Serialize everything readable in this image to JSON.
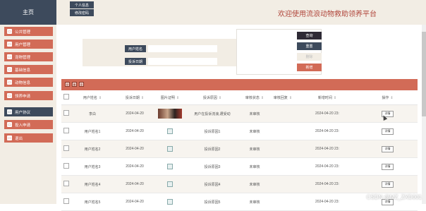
{
  "brand": "主页",
  "top_buttons": [
    "个人信息",
    "修改密码"
  ],
  "site_title": "欢迎使用流浪动物救助领养平台",
  "sidebar": [
    {
      "label": "公共管理",
      "icon": "monitor-icon",
      "active": false
    },
    {
      "label": "用户管理",
      "icon": "monitor-icon",
      "active": false
    },
    {
      "label": "宠物管理",
      "icon": "monitor-icon",
      "active": false
    },
    {
      "label": "基础信息",
      "icon": "monitor-icon",
      "active": false
    },
    {
      "label": "动物信息",
      "icon": "monitor-icon",
      "active": false
    },
    {
      "label": "领养申请",
      "icon": "monitor-icon",
      "active": false
    },
    {
      "label": "用户协议",
      "icon": "monitor-icon",
      "active": true
    },
    {
      "label": "投入申请",
      "icon": "monitor-icon",
      "active": false
    },
    {
      "label": "退出",
      "icon": "monitor-icon",
      "active": false
    }
  ],
  "search": {
    "fields": [
      {
        "label": "用户姓名",
        "value": "",
        "placeholder": ""
      },
      {
        "label": "投诉日期",
        "value": "",
        "placeholder": ""
      }
    ]
  },
  "actions": {
    "query": "查询",
    "reset": "重置",
    "delete": "删除",
    "add": "新增"
  },
  "toolbar_icons": [
    "export-icon",
    "print-icon",
    "columns-icon"
  ],
  "table": {
    "columns": [
      "用户姓名",
      "投诉日期",
      "图片证明",
      "投诉原因",
      "审核状态",
      "审核回复",
      "新增时间",
      "操作"
    ],
    "rows": [
      {
        "name": "李白",
        "date": "2024-04-20",
        "image": "photo",
        "reason": "用户在投诉流浪,遭受动",
        "status": "未审核",
        "reply": "",
        "created": "2024-04-20 23:",
        "op": "详情"
      },
      {
        "name": "用户姓名1",
        "date": "2024-04-20",
        "image": "broken",
        "reason": "投诉原因1",
        "status": "未审核",
        "reply": "",
        "created": "2024-04-20 23:",
        "op": "详情"
      },
      {
        "name": "用户姓名2",
        "date": "2024-04-20",
        "image": "broken",
        "reason": "投诉原因2",
        "status": "未审核",
        "reply": "",
        "created": "2024-04-20 23:",
        "op": "详情"
      },
      {
        "name": "用户姓名3",
        "date": "2024-04-20",
        "image": "broken",
        "reason": "投诉原因3",
        "status": "未审核",
        "reply": "",
        "created": "2024-04-20 23:",
        "op": "详情"
      },
      {
        "name": "用户姓名4",
        "date": "2024-04-20",
        "image": "broken",
        "reason": "投诉原因4",
        "status": "未审核",
        "reply": "",
        "created": "2024-04-20 23:",
        "op": "详情"
      },
      {
        "name": "用户姓名5",
        "date": "2024-04-20",
        "image": "broken",
        "reason": "投诉原因5",
        "status": "未审核",
        "reply": "",
        "created": "2024-04-20 23:",
        "op": "详情"
      }
    ]
  },
  "watermark": "CSDN @MZ_ZXD001",
  "colors": {
    "accent": "#d26b57",
    "dark": "#3d4a5c",
    "cream": "#f2ede4",
    "title": "#b0453a"
  }
}
